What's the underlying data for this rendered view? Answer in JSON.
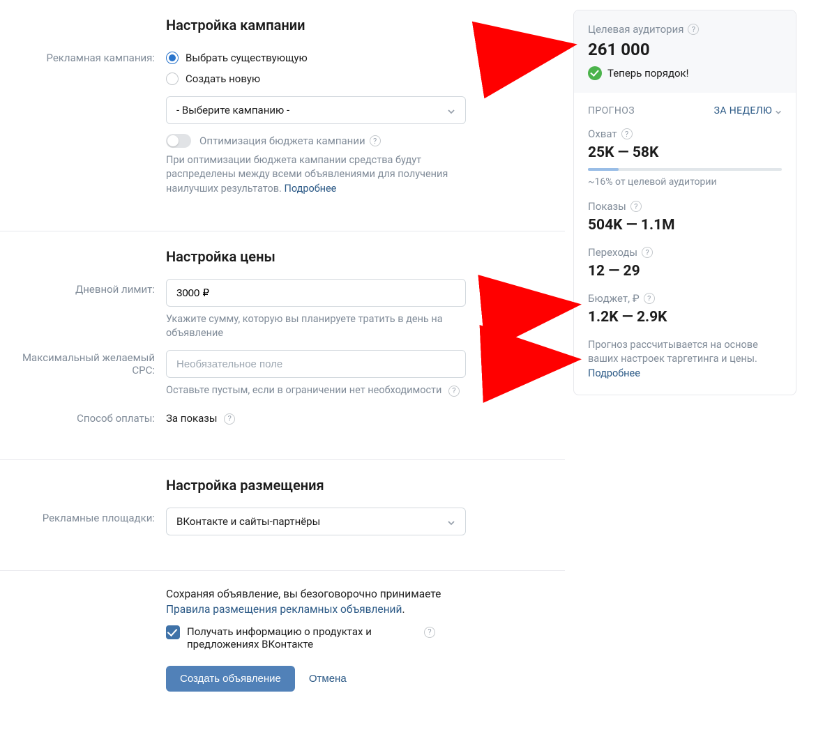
{
  "campaign": {
    "heading": "Настройка кампании",
    "label": "Рекламная кампания:",
    "radio_existing": "Выбрать существующую",
    "radio_new": "Создать новую",
    "select_placeholder": "- Выберите кампанию -",
    "toggle_label": "Оптимизация бюджета кампании",
    "toggle_hint": "При оптимизации бюджета кампании средства будут распределены между всеми объявлениями для получения наилучших результатов.",
    "toggle_more": "Подробнее"
  },
  "price": {
    "heading": "Настройка цены",
    "daily_label": "Дневной лимит:",
    "daily_value": "3000 ₽",
    "daily_hint": "Укажите сумму, которую вы планируете тратить в день на объявление",
    "cpc_label": "Максимальный желаемый CPC:",
    "cpc_placeholder": "Необязательное поле",
    "cpc_hint": "Оставьте пустым, если в ограничении нет необходимости",
    "pay_label": "Способ оплаты:",
    "pay_value": "За показы"
  },
  "placement": {
    "heading": "Настройка размещения",
    "label": "Рекламные площадки:",
    "value": "ВКонтакте и сайты-партнёры"
  },
  "terms": {
    "intro": "Сохраняя объявление, вы безоговорочно принимаете",
    "link": "Правила размещения рекламных объявлений",
    "checkbox_label": "Получать информацию о продуктах и предложениях ВКонтакте",
    "create_btn": "Создать объявление",
    "cancel_btn": "Отмена"
  },
  "sidebar": {
    "audience_label": "Целевая аудитория",
    "audience_value": "261 000",
    "status": "Теперь порядок!",
    "forecast_head": "ПРОГНОЗ",
    "period": "ЗА НЕДЕЛЮ",
    "reach_label": "Охват",
    "reach_value": "25K — 58K",
    "reach_sub": "~16% от целевой аудитории",
    "impressions_label": "Показы",
    "impressions_value": "504K — 1.1M",
    "clicks_label": "Переходы",
    "clicks_value": "12 — 29",
    "budget_label": "Бюджет, ₽",
    "budget_value": "1.2K — 2.9K",
    "note": "Прогноз рассчитывается на основе ваших настроек таргетинга и цены.",
    "note_link": "Подробнее"
  }
}
